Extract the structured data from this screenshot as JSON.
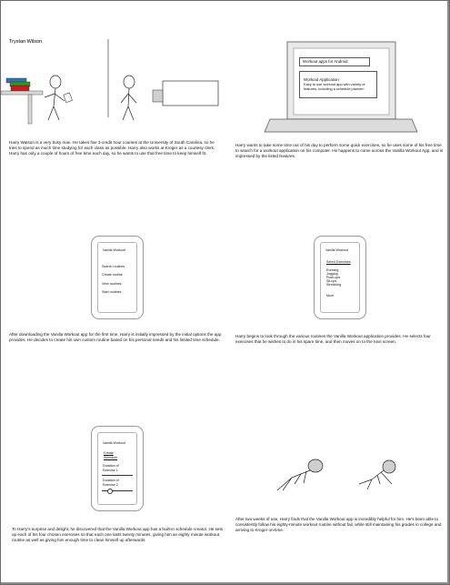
{
  "author": "Trystan Wilson",
  "panels": {
    "p1": {
      "caption": "Harry Watson is a very busy man.  He takes five 3-credit hour courses at the University of South Carolina, so he tries to spend as much time studying for each class as possible.  Harry also works at Kroger as a courtesy clerk.  Harry has only a couple of hours of free time each day, so he wants to use that free time to keep himself fit."
    },
    "p2": {
      "search_bar": "Workout apps for Android",
      "result_title": "Workout Application",
      "result_desc": "Easy to use workout app with variety of features, including a schedule planner!",
      "caption": "Harry wants to take some time out of his day to perform some quick exercises, so he uses some of his free time to search for a workout application on his computer.  He happens to come across the Vanilla Workout App, and is impressed by the listed features."
    },
    "p3": {
      "app_title": "Vanilla Workout",
      "menu": [
        "Search routines",
        "Create routine",
        "View routines",
        "Start routines"
      ],
      "caption": "After downloading the Vanilla Workout app for the first time, Harry is initially impressed by the initial options the app provides.  He decides to create his own custom routine based on his personal needs and his limited time schedule."
    },
    "p4": {
      "app_title": "Vanilla Workout",
      "section": "Select Exercises",
      "exercises": [
        "Running",
        "Jogging",
        "Push-ups",
        "Sit-ups",
        "Stretching"
      ],
      "more": "More",
      "caption": "Harry begins to look through the various routines the Vanilla Workout application provides.  He selects four exercises that he wishes to do in his spare time, and then moves on to the next screen."
    },
    "p5": {
      "app_title": "Vanilla Workout",
      "section_line1": "Create",
      "section_line2": "Schedule",
      "field1_line1": "Duration of",
      "field1_line2": "Exercise 1",
      "field2_line1": "Duration of",
      "field2_line2": "Exercise 2",
      "caption": "To Harry's surprise and delight, he discovered that the Vanilla Workout app has a built-in schedule creator.  He sets up each of his four chosen exercises so that each one lasts twenty minutes, giving him an eighty minute workout routine as well as giving him enough time to clean himself up afterwards."
    },
    "p6": {
      "caption": "After two weeks of use, Harry finds that the Vanilla Workout app is incredibly helpful for him.  He's been able to consistently follow his eighty-minute workout routine without fail, while still maintaining his grades in college and arriving to Kroger on-time."
    }
  }
}
